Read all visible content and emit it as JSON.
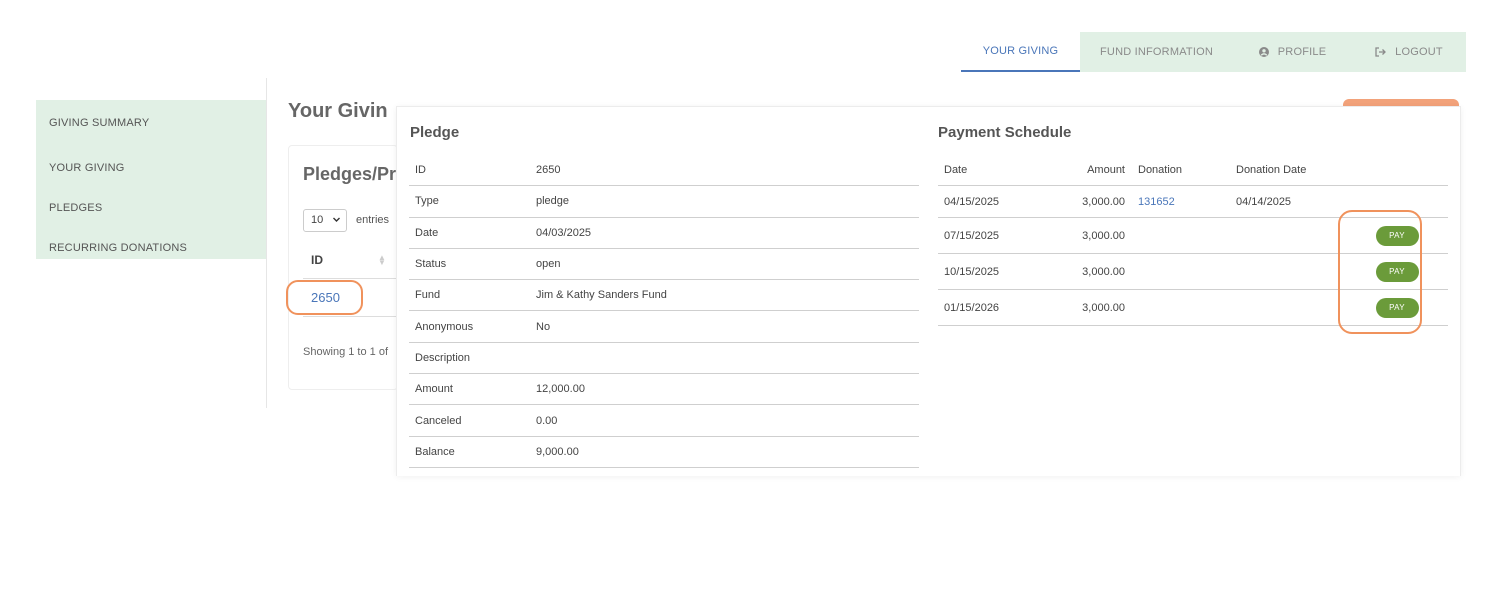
{
  "nav": {
    "tabs": [
      {
        "label": "YOUR GIVING",
        "active": true
      },
      {
        "label": "FUND INFORMATION",
        "active": false
      },
      {
        "label": "PROFILE",
        "icon": "user-circle-icon",
        "active": false
      },
      {
        "label": "LOGOUT",
        "icon": "logout-icon",
        "active": false
      }
    ]
  },
  "sidebar": {
    "items": [
      {
        "label": "GIVING SUMMARY"
      },
      {
        "label": "YOUR GIVING"
      },
      {
        "label": "PLEDGES"
      },
      {
        "label": "RECURRING DONATIONS"
      }
    ]
  },
  "background": {
    "page_title": "Your Givin",
    "card_title": "Pledges/Pr",
    "page_length": "10",
    "entries_label": "entries",
    "id_header": "ID",
    "id_value": "2650",
    "showing_text": "Showing 1 to 1 of"
  },
  "pledge": {
    "title": "Pledge",
    "rows": [
      {
        "label": "ID",
        "value": "2650"
      },
      {
        "label": "Type",
        "value": "pledge"
      },
      {
        "label": "Date",
        "value": "04/03/2025"
      },
      {
        "label": "Status",
        "value": "open"
      },
      {
        "label": "Fund",
        "value": "Jim & Kathy Sanders Fund"
      },
      {
        "label": "Anonymous",
        "value": "No"
      },
      {
        "label": "Description",
        "value": ""
      },
      {
        "label": "Amount",
        "value": "12,000.00"
      },
      {
        "label": "Canceled",
        "value": "0.00"
      },
      {
        "label": "Balance",
        "value": "9,000.00"
      }
    ]
  },
  "schedule": {
    "title": "Payment Schedule",
    "headers": {
      "date": "Date",
      "amount": "Amount",
      "donation": "Donation",
      "donation_date": "Donation Date"
    },
    "rows": [
      {
        "date": "04/15/2025",
        "amount": "3,000.00",
        "donation": "131652",
        "donation_date": "04/14/2025",
        "pay": ""
      },
      {
        "date": "07/15/2025",
        "amount": "3,000.00",
        "donation": "",
        "donation_date": "",
        "pay": "PAY"
      },
      {
        "date": "10/15/2025",
        "amount": "3,000.00",
        "donation": "",
        "donation_date": "",
        "pay": "PAY"
      },
      {
        "date": "01/15/2026",
        "amount": "3,000.00",
        "donation": "",
        "donation_date": "",
        "pay": "PAY"
      }
    ]
  },
  "colors": {
    "accent_blue": "#4a76b9",
    "nav_bg": "#e1f0e5",
    "pay_green": "#6b9b3a",
    "highlight_orange": "#f0925c"
  }
}
